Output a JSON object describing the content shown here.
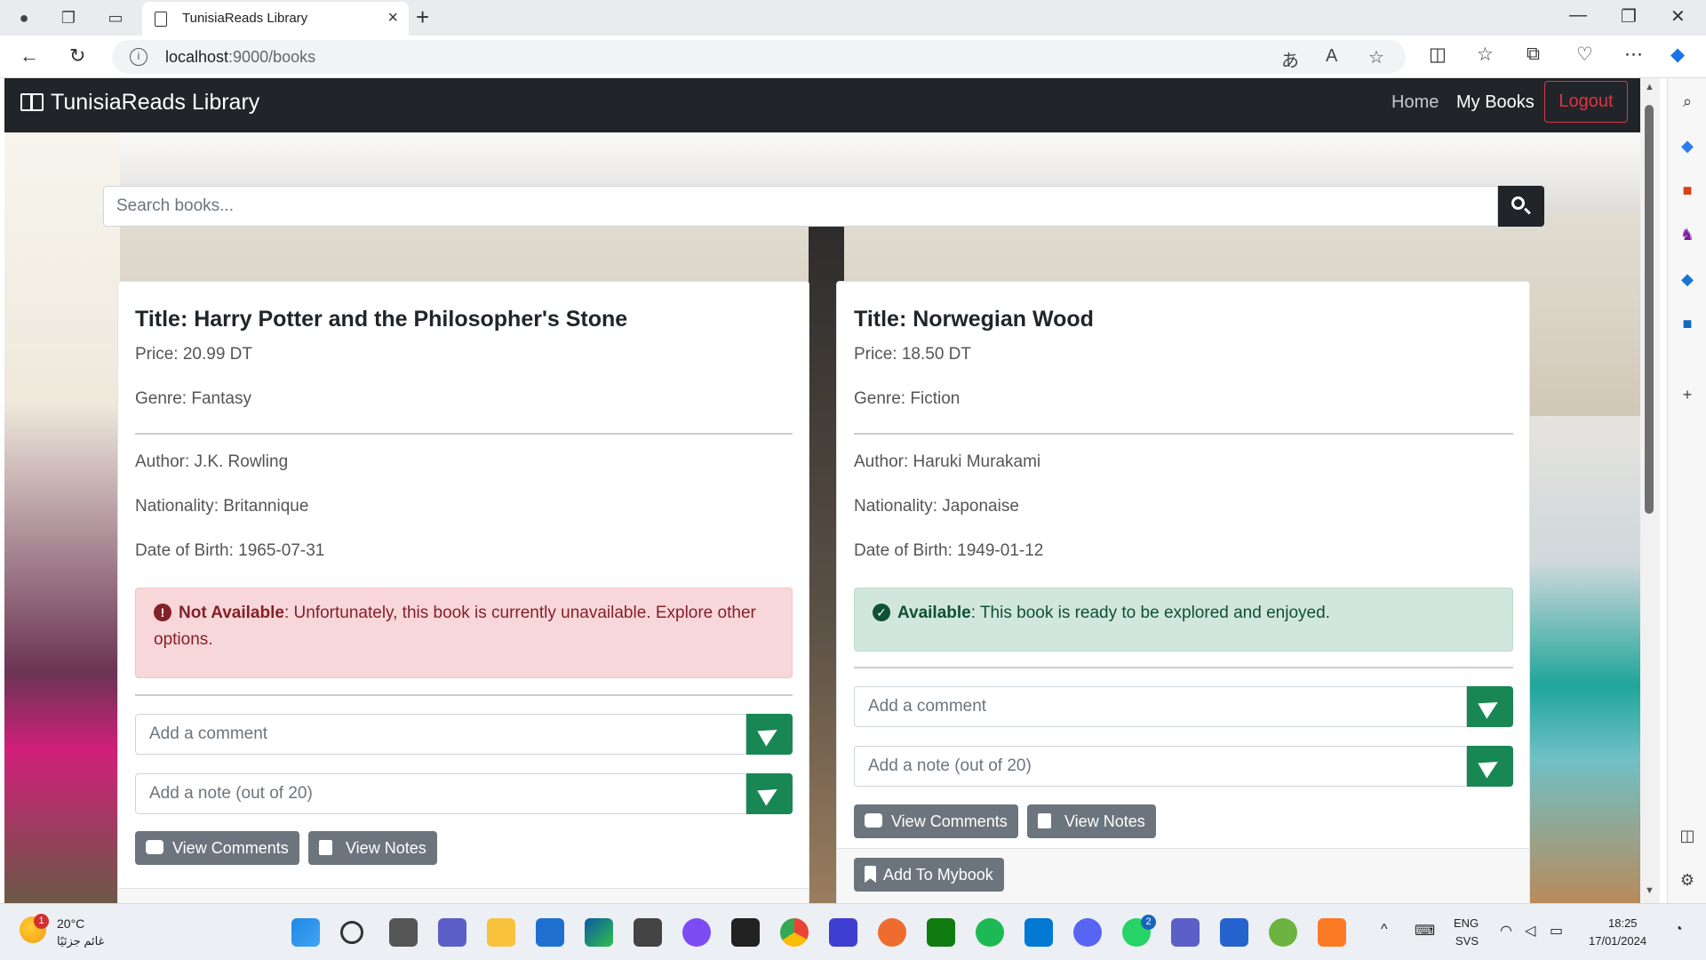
{
  "browser": {
    "tab_title": "TunisiaReads Library",
    "url_host": "localhost",
    "url_path": ":9000/books"
  },
  "navbar": {
    "brand": "TunisiaReads Library",
    "links": [
      "Home",
      "My Books"
    ],
    "logout": "Logout"
  },
  "search": {
    "placeholder": "Search books..."
  },
  "books": [
    {
      "title": "Title: Harry Potter and the Philosopher's Stone",
      "price": "Price: 20.99 DT",
      "genre": "Genre: Fantasy",
      "author": "Author: J.K. Rowling",
      "nationality": "Nationality: Britannique",
      "dob": "Date of Birth: 1965-07-31",
      "status_label": "Not Available",
      "status_text": ": Unfortunately, this book is currently unavailable. Explore other options.",
      "comment_placeholder": "Add a comment",
      "note_placeholder": "Add a note (out of 20)",
      "view_comments": "View Comments",
      "view_notes": "View Notes"
    },
    {
      "title": "Title: Norwegian Wood",
      "price": "Price: 18.50 DT",
      "genre": "Genre: Fiction",
      "author": "Author: Haruki Murakami",
      "nationality": "Nationality: Japonaise",
      "dob": "Date of Birth: 1949-01-12",
      "status_label": "Available",
      "status_text": ": This book is ready to be explored and enjoyed.",
      "comment_placeholder": "Add a comment",
      "note_placeholder": "Add a note (out of 20)",
      "view_comments": "View Comments",
      "view_notes": "View Notes",
      "add_mybook": "Add To Mybook"
    }
  ],
  "taskbar": {
    "temperature": "20°C",
    "weather_caption": "غائم جزئيًا",
    "weather_badge": "1",
    "lang": "ENG",
    "layout": "SVS",
    "time": "18:25",
    "date": "17/01/2024",
    "whatsapp_badge": "2"
  }
}
